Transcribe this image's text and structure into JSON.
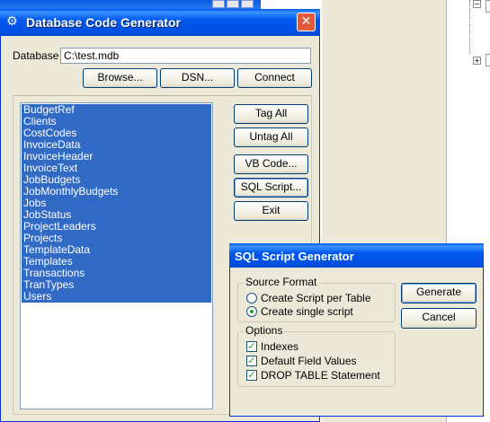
{
  "main_dialog": {
    "title": "Database Code Generator",
    "database_label": "Database",
    "database_value": "C:\\test.mdb",
    "buttons": {
      "browse": "Browse...",
      "dsn": "DSN...",
      "connect": "Connect",
      "tag_all": "Tag All",
      "untag_all": "Untag All",
      "vb_code": "VB Code...",
      "sql_script": "SQL Script...",
      "exit": "Exit"
    },
    "tables": [
      "BudgetRef",
      "Clients",
      "CostCodes",
      "InvoiceData",
      "InvoiceHeader",
      "InvoiceText",
      "JobBudgets",
      "JobMonthlyBudgets",
      "Jobs",
      "JobStatus",
      "ProjectLeaders",
      "Projects",
      "TemplateData",
      "Templates",
      "Transactions",
      "TranTypes",
      "Users"
    ]
  },
  "sql_dialog": {
    "title": "SQL Script Generator",
    "source_format": {
      "legend": "Source Format",
      "options": [
        "Create Script per Table",
        "Create single script"
      ],
      "selected": "Create single script"
    },
    "options_group": {
      "legend": "Options",
      "items": [
        {
          "label": "Indexes",
          "checked": true
        },
        {
          "label": "Default Field Values",
          "checked": true
        },
        {
          "label": "DROP TABLE Statement",
          "checked": true
        }
      ]
    },
    "buttons": {
      "generate": "Generate",
      "cancel": "Cancel"
    }
  },
  "colors": {
    "titlebar": "#0058ee",
    "selection": "#316ac5",
    "dialog_face": "#ece9d8"
  },
  "icons": {
    "app": "database-gear-icon",
    "close": "close-icon",
    "tree_expander": "tree-expand-icon"
  }
}
